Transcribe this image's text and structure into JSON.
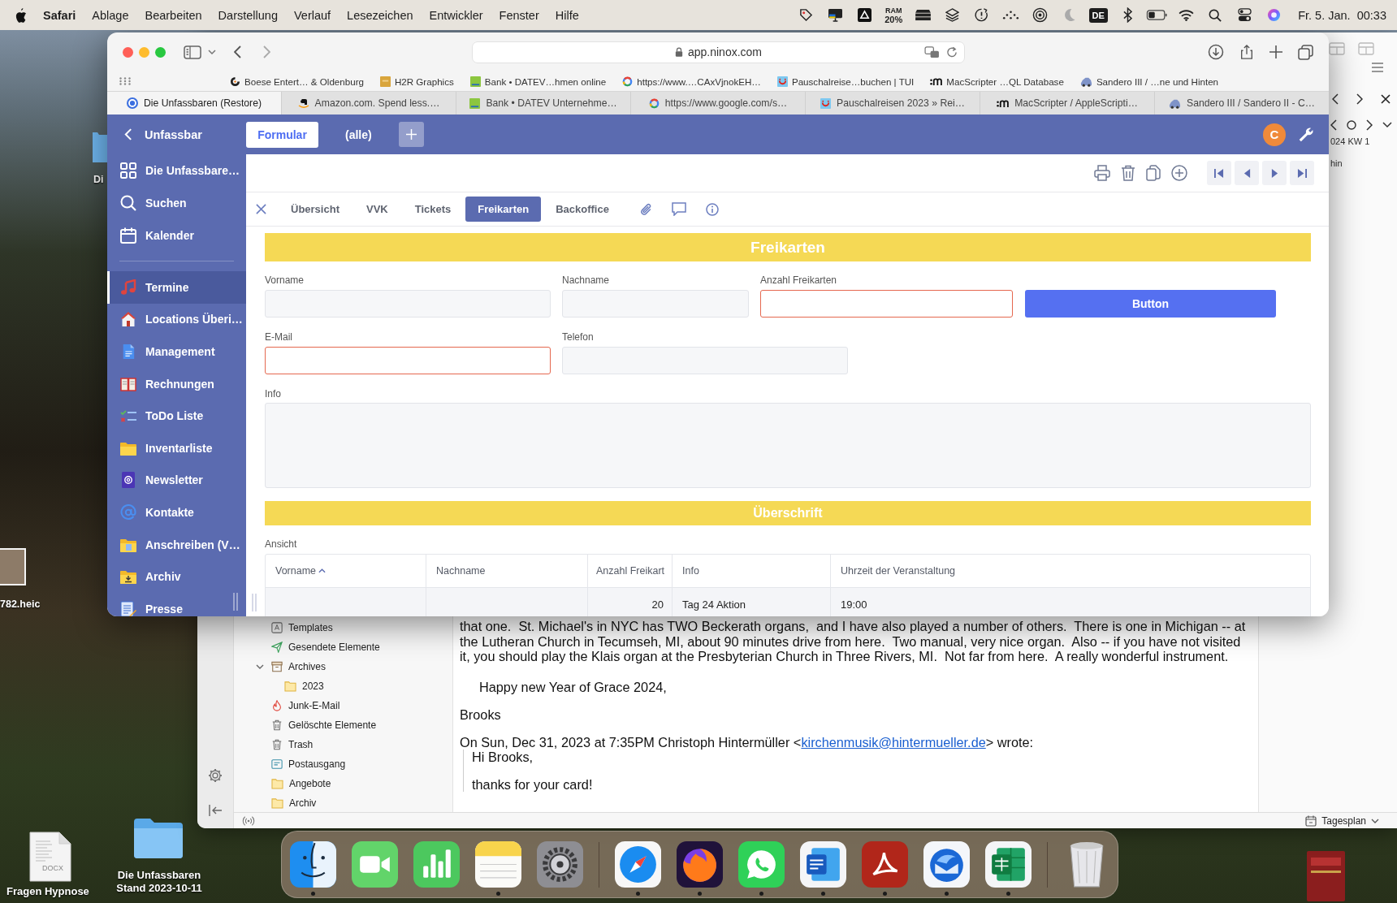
{
  "menu_bar": {
    "app_name": "Safari",
    "menus": [
      "Ablage",
      "Bearbeiten",
      "Darstellung",
      "Verlauf",
      "Lesezeichen",
      "Entwickler",
      "Fenster",
      "Hilfe"
    ],
    "ram_label": "RAM",
    "ram_value": "20%",
    "input_source": "DE",
    "clock": "Fr. 5. Jan.  00:33"
  },
  "desktop": {
    "items": [
      {
        "label": "Di"
      },
      {
        "label": "782.heic"
      },
      {
        "label": "Fragen Hypnose",
        "badge": "DOCX"
      },
      {
        "label": "Die Unfassbaren Stand 2023-10-11"
      }
    ]
  },
  "mail": {
    "folders": [
      {
        "label": "Templates",
        "kind": "templates"
      },
      {
        "label": "Gesendete Elemente",
        "kind": "sent"
      },
      {
        "label": "Archives",
        "kind": "archive",
        "expanded": true,
        "children": [
          {
            "label": "2023",
            "kind": "folder"
          }
        ]
      },
      {
        "label": "Junk-E-Mail",
        "kind": "junk"
      },
      {
        "label": "Gelöschte Elemente",
        "kind": "trash"
      },
      {
        "label": "Trash",
        "kind": "trash"
      },
      {
        "label": "Postausgang",
        "kind": "outbox"
      },
      {
        "label": "Angebote",
        "kind": "folder"
      },
      {
        "label": "Archiv",
        "kind": "folder"
      }
    ],
    "message": {
      "paragraph": "that one.  St. Michael's in NYC has TWO Beckerath organs,  and I have also played a number of others.  There is one in Michigan -- at the Lutheran Church in Tecumseh, MI, about 90 minutes drive from here.  Two manual, very nice organ.  Also -- if you have not visited it, you should play the Klais organ at the Presbyterian Church in Three Rivers, MI.  Not far from here.  A really wonderful instrument.",
      "greeting": "Happy new Year of Grace 2024,",
      "signature": "Brooks",
      "reply_intro": "On Sun, Dec 31, 2023 at 7:35PM Christoph Hintermüller <",
      "reply_link": "kirchenmusik@hintermueller.de",
      "reply_outro": "> wrote:",
      "quote": [
        "Hi Brooks,",
        "thanks for your card!"
      ]
    },
    "calendar": {
      "week": "024 KW 1",
      "column_text": "hin",
      "view": "Tagesplan"
    }
  },
  "browser": {
    "url": "app.ninox.com",
    "bookmarks": [
      "Boese Entert… & Oldenburg",
      "H2R Graphics",
      "Bank • DATEV…hmen online",
      "https://www.…CAxVjnokEH…",
      "Pauschalreise…buchen | TUI",
      "MacScripter …QL Database",
      "Sandero III / …ne und Hinten"
    ],
    "tabs": [
      {
        "title": "Die Unfassbaren (Restore)",
        "selected": true
      },
      {
        "title": "Amazon.com. Spend less.…",
        "selected": false
      },
      {
        "title": "Bank • DATEV Unternehme…",
        "selected": false
      },
      {
        "title": "https://www.google.com/s…",
        "selected": false
      },
      {
        "title": "Pauschalreisen 2023 » Rei…",
        "selected": false
      },
      {
        "title": "MacScripter / AppleScripti…",
        "selected": false
      },
      {
        "title": "Sandero III / Sandero II - C…",
        "selected": false
      }
    ]
  },
  "app": {
    "header": {
      "back_label": "Unfassbar",
      "views": [
        {
          "label": "Formular",
          "selected": true
        },
        {
          "label": "(alle)",
          "selected": false
        }
      ],
      "user_initial": "C"
    },
    "nav": [
      {
        "label": "Die Unfassbare…"
      },
      {
        "label": "Suchen"
      },
      {
        "label": "Kalender"
      }
    ],
    "tables": [
      {
        "label": "Termine",
        "selected": true
      },
      {
        "label": "Locations Überi…",
        "selected": false
      },
      {
        "label": "Management",
        "selected": false
      },
      {
        "label": "Rechnungen",
        "selected": false
      },
      {
        "label": "ToDo Liste",
        "selected": false
      },
      {
        "label": "Inventarliste",
        "selected": false
      },
      {
        "label": "Newsletter",
        "selected": false
      },
      {
        "label": "Kontakte",
        "selected": false
      },
      {
        "label": "Anschreiben (V…",
        "selected": false
      },
      {
        "label": "Archiv",
        "selected": false
      },
      {
        "label": "Presse",
        "selected": false
      }
    ],
    "record_tabs": [
      {
        "label": "Übersicht",
        "selected": false
      },
      {
        "label": "VVK",
        "selected": false
      },
      {
        "label": "Tickets",
        "selected": false
      },
      {
        "label": "Freikarten",
        "selected": true
      },
      {
        "label": "Backoffice",
        "selected": false
      }
    ],
    "form": {
      "title": "Freikarten",
      "rows": [
        [
          {
            "kind": "field",
            "label": "Vorname",
            "invalid": false
          },
          {
            "kind": "field",
            "label": "Nachname",
            "invalid": false
          },
          {
            "kind": "field",
            "label": "Anzahl Freikarten",
            "invalid": true
          },
          {
            "kind": "button",
            "label": "Button"
          }
        ],
        [
          {
            "kind": "field",
            "label": "E-Mail",
            "invalid": true
          },
          {
            "kind": "field",
            "label": "Telefon",
            "invalid": false
          }
        ]
      ],
      "info_label": "Info",
      "subtitle": "Überschrift",
      "view": {
        "label": "Ansicht",
        "columns": [
          {
            "label": "Vorname",
            "sorted": true
          },
          {
            "label": "Nachname",
            "sorted": false
          },
          {
            "label": "Anzahl Freikart",
            "sorted": false
          },
          {
            "label": "Info",
            "sorted": false
          },
          {
            "label": "Uhrzeit der Veranstaltung",
            "sorted": false
          }
        ],
        "rows": [
          {
            "anzahl_freikarten": "20",
            "info": "Tag 24 Aktion",
            "uhrzeit_der_veranstaltung": "19:00"
          }
        ]
      }
    }
  },
  "dock": {
    "apps": [
      {
        "running": true
      },
      {
        "running": false
      },
      {
        "running": false
      },
      {
        "running": true
      },
      {
        "running": false
      },
      {
        "running": true
      },
      {
        "running": true
      },
      {
        "running": true
      },
      {
        "running": true
      },
      {
        "running": true
      },
      {
        "running": true
      },
      {
        "running": true
      },
      {
        "running": false
      }
    ]
  }
}
